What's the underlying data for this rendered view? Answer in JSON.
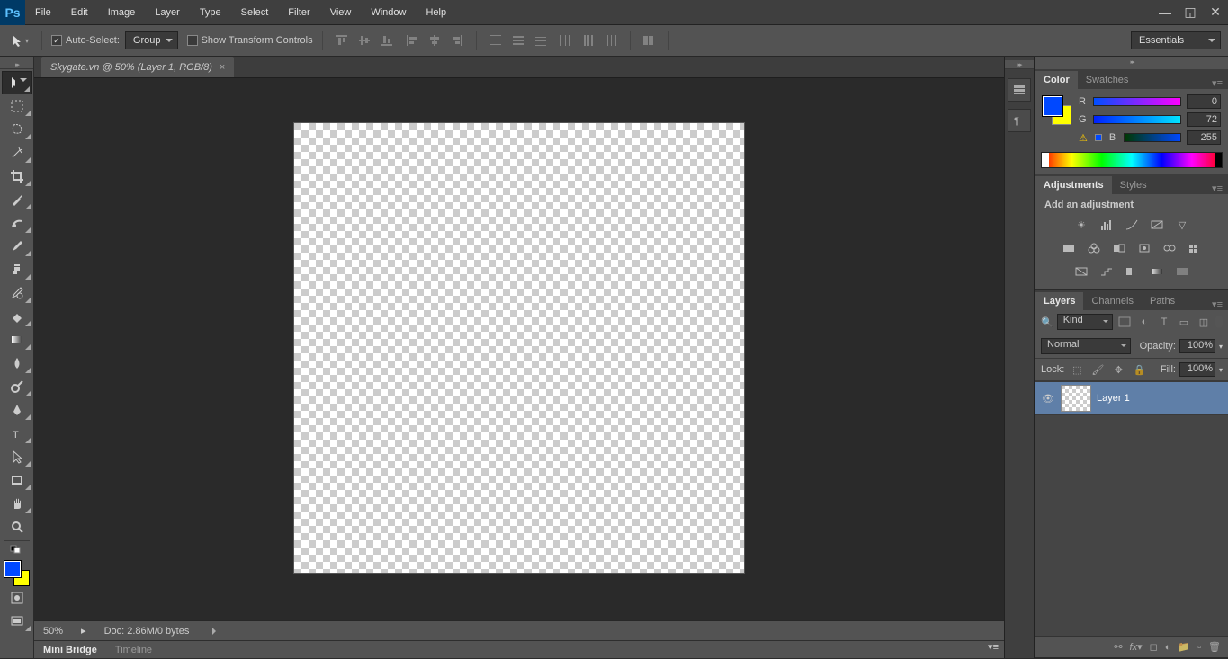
{
  "menu": [
    "File",
    "Edit",
    "Image",
    "Layer",
    "Type",
    "Select",
    "Filter",
    "View",
    "Window",
    "Help"
  ],
  "optbar": {
    "auto_select": "Auto-Select:",
    "group": "Group",
    "show_transform": "Show Transform Controls"
  },
  "workspace": "Essentials",
  "doc_tab": "Skygate.vn @ 50% (Layer 1, RGB/8)",
  "status": {
    "zoom": "50%",
    "doc": "Doc: 2.86M/0 bytes"
  },
  "bottom_tabs": [
    "Mini Bridge",
    "Timeline"
  ],
  "panels": {
    "color": {
      "tab1": "Color",
      "tab2": "Swatches",
      "r": "R",
      "g": "G",
      "b": "B",
      "rv": "0",
      "gv": "72",
      "bv": "255"
    },
    "adjust": {
      "tab1": "Adjustments",
      "tab2": "Styles",
      "title": "Add an adjustment"
    },
    "layers": {
      "tab1": "Layers",
      "tab2": "Channels",
      "tab3": "Paths",
      "kind_lbl": "Kind",
      "kind": "Kind",
      "blend": "Normal",
      "opacity_lbl": "Opacity:",
      "opacity": "100%",
      "lock_lbl": "Lock:",
      "fill_lbl": "Fill:",
      "fill": "100%",
      "layer1": "Layer 1"
    }
  }
}
